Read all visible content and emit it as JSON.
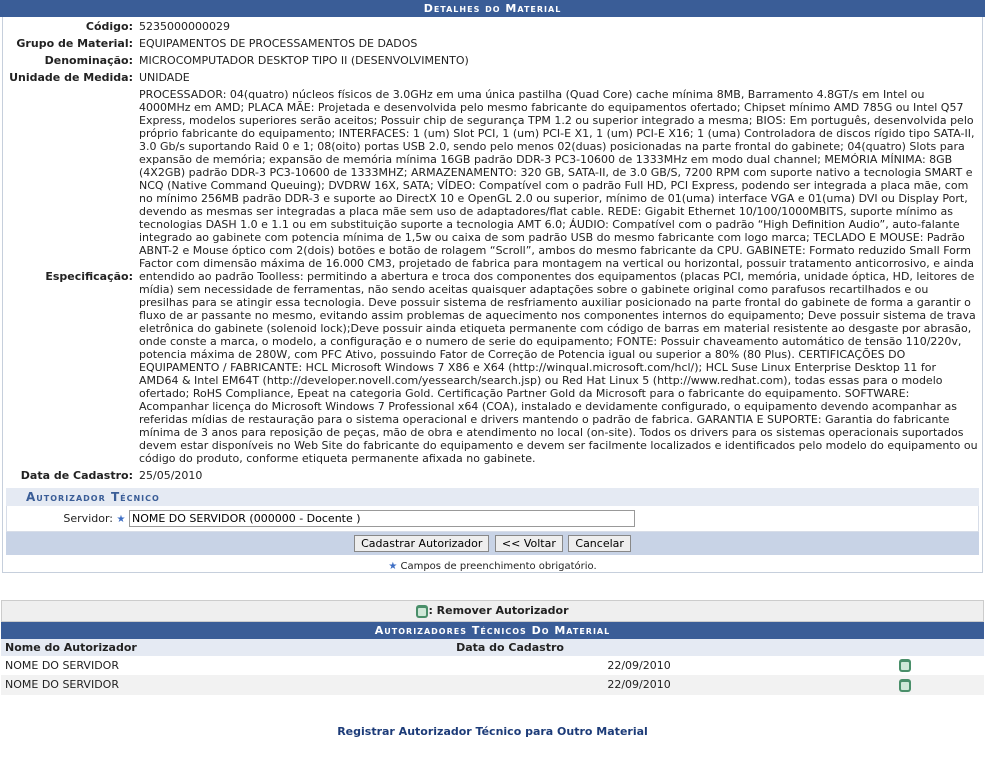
{
  "title": "Detalhes do Material",
  "fields": {
    "codigo_label": "Código:",
    "codigo": "5235000000029",
    "grupo_label": "Grupo de Material:",
    "grupo": "EQUIPAMENTOS DE PROCESSAMENTOS DE DADOS",
    "denominacao_label": "Denominação:",
    "denominacao": "MICROCOMPUTADOR DESKTOP TIPO II (DESENVOLVIMENTO)",
    "unidade_label": "Unidade de Medida:",
    "unidade": "UNIDADE",
    "especificacao_label": "Especificação:",
    "especificacao": "PROCESSADOR: 04(quatro) núcleos físicos de 3.0GHz em uma única pastilha (Quad Core) cache mínima 8MB, Barramento 4.8GT/s em Intel ou 4000MHz em AMD; PLACA MÃE: Projetada e desenvolvida pelo mesmo fabricante do equipamentos ofertado; Chipset mínimo AMD 785G ou Intel Q57 Express, modelos superiores serão aceitos; Possuir chip de segurança TPM 1.2 ou superior integrado a mesma; BIOS: Em português, desenvolvida pelo próprio fabricante do equipamento; INTERFACES: 1 (um) Slot PCI, 1 (um) PCI-E X1, 1 (um) PCI-E X16; 1 (uma) Controladora de discos rígido tipo SATA-II, 3.0 Gb/s suportando Raid 0 e 1; 08(oito) portas USB 2.0, sendo pelo menos 02(duas) posicionadas na parte frontal do gabinete; 04(quatro) Slots para expansão de memória; expansão de memória mínima 16GB padrão DDR-3 PC3-10600 de 1333MHz em modo dual channel; MEMÓRIA MÍNIMA: 8GB (4X2GB) padrão DDR-3 PC3-10600 de 1333MHZ; ARMAZENAMENTO: 320 GB, SATA-II, de 3.0 GB/S, 7200 RPM com suporte nativo a tecnologia SMART e NCQ (Native Command Queuing); DVDRW 16X, SATA; VÍDEO: Compatível com o padrão Full HD, PCI Express, podendo ser integrada a placa mãe, com no mínimo 256MB padrão DDR-3 e suporte ao DirectX 10 e OpenGL 2.0 ou superior, mínimo de 01(uma) interface VGA e 01(uma) DVI ou Display Port, devendo as mesmas ser integradas a placa mãe sem uso de adaptadores/flat cable. REDE: Gigabit Ethernet 10/100/1000MBITS, suporte mínimo as tecnologias DASH 1.0 e 1.1 ou em substituição suporte a tecnologia AMT 6.0; ÁUDIO: Compatível com o padrão “High Definition Audio”, auto-falante integrado ao gabinete com potencia mínima de 1,5w ou caixa de som padrão USB do mesmo fabricante com logo marca; TECLADO E MOUSE: Padrão ABNT-2 e Mouse óptico com 2(dois) botões e botão de rolagem “Scroll”, ambos do mesmo fabricante da CPU. GABINETE: Formato reduzido Small Form Factor com dimensão máxima de 16.000 CM3, projetado de fabrica para montagem na vertical ou horizontal, possuir tratamento anticorrosivo, e ainda entendido ao padrão Toolless: permitindo a abertura e troca dos componentes dos equipamentos (placas PCI, memória, unidade óptica, HD, leitores de mídia) sem necessidade de ferramentas, não sendo aceitas quaisquer adaptações sobre o gabinete original como parafusos recartilhados e ou presilhas para se atingir essa tecnologia. Deve possuir sistema de resfriamento auxiliar posicionado na parte frontal do gabinete de forma a garantir o fluxo de ar passante no mesmo, evitando assim problemas de aquecimento nos componentes internos do equipamento; Deve possuir sistema de trava eletrônica do gabinete (solenoid lock);Deve possuir ainda etiqueta permanente com código de barras em material resistente ao desgaste por abrasão, onde conste a marca, o modelo, a configuração e o numero de serie do equipamento; FONTE: Possuir chaveamento automático de tensão 110/220v, potencia máxima de 280W, com PFC Ativo, possuindo Fator de Correção de Potencia igual ou superior a 80% (80 Plus). CERTIFICAÇÕES DO EQUIPAMENTO / FABRICANTE: HCL Microsoft Windows 7 X86 e X64 (http://winqual.microsoft.com/hcl/); HCL Suse Linux Enterprise Desktop 11 for AMD64 & Intel EM64T (http://developer.novell.com/yessearch/search.jsp) ou Red Hat Linux 5 (http://www.redhat.com), todas essas para o modelo ofertado; RoHS Compliance, Epeat na categoria Gold. Certificação Partner Gold da Microsoft para o fabricante do equipamento. SOFTWARE: Acompanhar licença do Microsoft Windows 7 Professional x64 (COA), instalado e devidamente configurado, o equipamento devendo acompanhar as referidas mídias de restauração para o sistema operacional e drivers mantendo o padrão de fabrica. GARANTIA E SUPORTE: Garantia do fabricante mínima de 3 anos para reposição de peças, mão de obra e atendimento no local (on-site). Todos os drivers para os sistemas operacionais suportados devem estar disponíveis no Web Site do fabricante do equipamento e devem ser facilmente localizados e identificados pelo modelo do equipamento ou código do produto, conforme etiqueta permanente afixada no gabinete.",
    "data_label": "Data de Cadastro:",
    "data": "25/05/2010"
  },
  "autorizador": {
    "section_title": "Autorizador Técnico",
    "servidor_label": "Servidor:",
    "servidor_value": "NOME DO SERVIDOR (000000 - Docente )",
    "btn_cadastrar": "Cadastrar Autorizador",
    "btn_voltar": "<< Voltar",
    "btn_cancelar": "Cancelar",
    "required_note": "Campos de preenchimento obrigatório."
  },
  "legend": ": Remover Autorizador",
  "list": {
    "title": "Autorizadores Técnicos Do Material",
    "col_nome": "Nome do Autorizador",
    "col_data": "Data do Cadastro",
    "rows": [
      {
        "nome": "NOME DO SERVIDOR",
        "data": "22/09/2010"
      },
      {
        "nome": "NOME DO SERVIDOR",
        "data": "22/09/2010"
      }
    ]
  },
  "footer_link": "Registrar Autorizador Técnico para Outro Material",
  "icons": {
    "remove": "trash-icon",
    "required": "asterisk-icon"
  },
  "colors": {
    "header": "#3a5d97",
    "subheader_bg": "#e5eaf3",
    "button_bar": "#c8d3e6"
  }
}
